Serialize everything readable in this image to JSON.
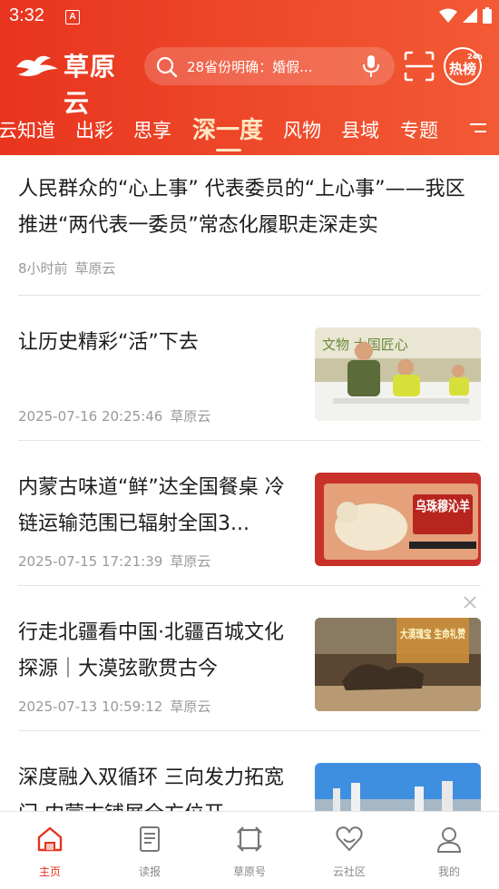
{
  "status_bar": {
    "time": "3:32",
    "notification_icon": "A"
  },
  "header": {
    "logo_text": "草原云",
    "search": {
      "text": "28省份明确：婚假..."
    },
    "hot_badge": {
      "label": "热榜",
      "sub": "24h"
    }
  },
  "tabs": [
    {
      "label": "云知道",
      "active": false
    },
    {
      "label": "出彩",
      "active": false
    },
    {
      "label": "思享",
      "active": false
    },
    {
      "label": "深一度",
      "active": true
    },
    {
      "label": "风物",
      "active": false
    },
    {
      "label": "县域",
      "active": false
    },
    {
      "label": "专题",
      "active": false
    }
  ],
  "articles": [
    {
      "title": "人民群众的“心上事” 代表委员的“上心事”——我区推进“两代表一委员”常态化履职走深走实",
      "time": "8小时前",
      "source": "草原云",
      "has_thumb": false
    },
    {
      "title": "让历史精彩“活”下去",
      "time": "2025-07-16 20:25:46",
      "source": "草原云",
      "has_thumb": true,
      "thumb_text": "文物 大国匠心"
    },
    {
      "title": "内蒙古味道“鲜”达全国餐桌 冷链运输范围已辐射全国3...",
      "time": "2025-07-15 17:21:39",
      "source": "草原云",
      "has_thumb": true,
      "thumb_text": "乌珠穆沁羊"
    },
    {
      "title": "行走北疆看中国·北疆百城文化探源｜大漠弦歌贯古今",
      "time": "2025-07-13 10:59:12",
      "source": "草原云",
      "has_thumb": true,
      "thumb_text": "大漠瑰宝 生命礼赞"
    },
    {
      "title": "深度融入双循环 三向发力拓宽门 内蒙古铺展全方位开",
      "time": "",
      "source": "",
      "has_thumb": true,
      "thumb_text": ""
    }
  ],
  "bottom_nav": [
    {
      "label": "主页",
      "icon": "home-icon",
      "active": true
    },
    {
      "label": "读报",
      "icon": "newspaper-icon",
      "active": false
    },
    {
      "label": "草原号",
      "icon": "frame-icon",
      "active": false
    },
    {
      "label": "云社区",
      "icon": "community-heart-icon",
      "active": false
    },
    {
      "label": "我的",
      "icon": "profile-icon",
      "active": false
    }
  ],
  "colors": {
    "brand_red": "#e8341e",
    "active_tab": "#ffe7c2",
    "nav_active": "#e5331d"
  }
}
